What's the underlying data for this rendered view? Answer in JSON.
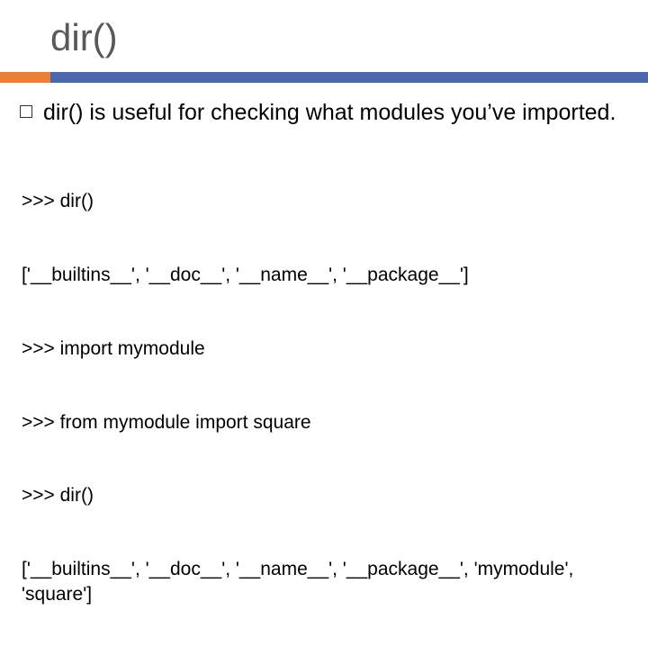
{
  "title": "dir()",
  "bullet": "dir() is useful for checking what modules you’ve imported.",
  "code_lines": [
    ">>> dir()",
    "['__builtins__', '__doc__', '__name__', '__package__']",
    ">>> import mymodule",
    ">>> from mymodule import square",
    ">>> dir()",
    "['__builtins__', '__doc__', '__name__', '__package__', 'mymodule', 'square']"
  ]
}
